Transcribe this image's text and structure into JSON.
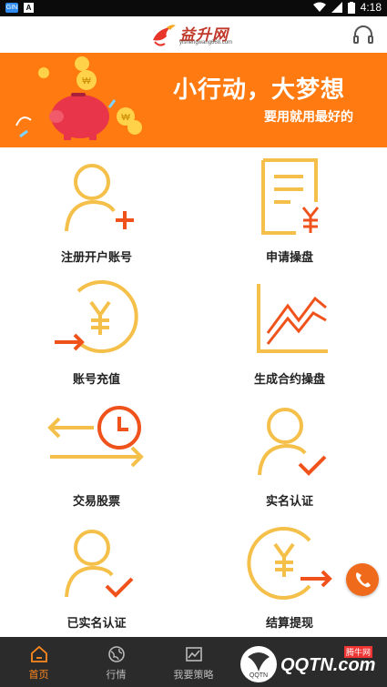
{
  "status_bar": {
    "time": "4:18",
    "app_badge": "GIN",
    "app_letter": "A"
  },
  "header": {
    "logo_title": "益升网",
    "logo_sub": "yishengwang668.com"
  },
  "banner": {
    "slogan": "小行动，大梦想",
    "sub": "要用就用最好的"
  },
  "grid": {
    "items": [
      {
        "label": "注册开户账号",
        "icon": "register-user-icon"
      },
      {
        "label": "申请操盘",
        "icon": "apply-document-icon"
      },
      {
        "label": "账号充值",
        "icon": "recharge-yuan-icon"
      },
      {
        "label": "生成合约操盘",
        "icon": "contract-chart-icon"
      },
      {
        "label": "交易股票",
        "icon": "trade-clock-icon"
      },
      {
        "label": "实名认证",
        "icon": "verify-user-icon"
      },
      {
        "label": "已实名认证",
        "icon": "verified-user-icon"
      },
      {
        "label": "结算提现",
        "icon": "withdraw-yuan-icon"
      }
    ]
  },
  "tabbar": {
    "tabs": [
      {
        "label": "首页",
        "icon": "home-icon",
        "active": true
      },
      {
        "label": "行情",
        "icon": "globe-icon",
        "active": false
      },
      {
        "label": "我要策略",
        "icon": "chart-icon",
        "active": false
      },
      {
        "label": "",
        "icon": "hidden-icon",
        "active": false
      },
      {
        "label": "",
        "icon": "user-icon",
        "active": false
      }
    ]
  },
  "watermark": {
    "text": "QQTN.com",
    "small": "腾牛网"
  },
  "colors": {
    "accent": "#f5a623",
    "orange": "#ff7a10",
    "arrow": "#f0521c",
    "tab_active": "#ff8a1f"
  }
}
